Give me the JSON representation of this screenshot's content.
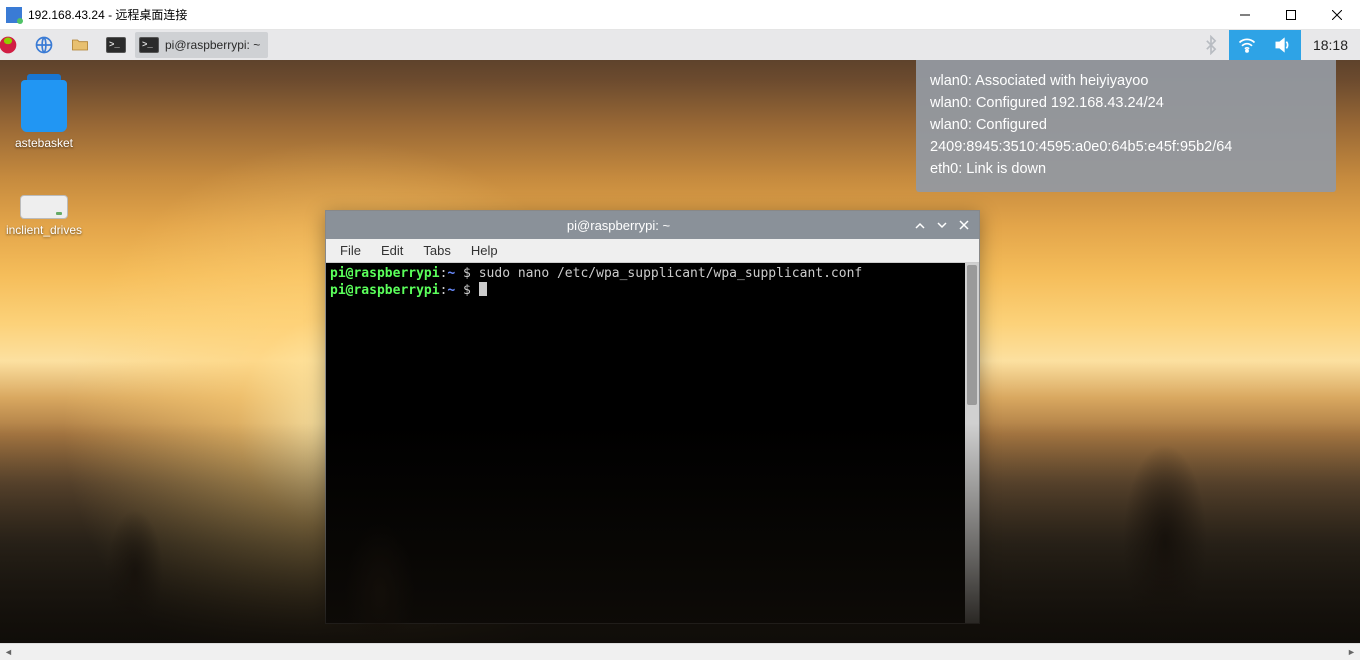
{
  "rdc": {
    "title": "192.168.43.24 - 远程桌面连接"
  },
  "panel": {
    "task_label": "pi@raspberrypi: ~",
    "clock": "18:18"
  },
  "desktop": {
    "trash_label": "astebasket",
    "drives_label": "inclient_drives"
  },
  "nettip": {
    "l1": "wlan0: Associated with heiyiyayoo",
    "l2": "wlan0: Configured 192.168.43.24/24",
    "l3": "wlan0: Configured 2409:8945:3510:4595:a0e0:64b5:e45f:95b2/64",
    "l4": "eth0: Link is down"
  },
  "termwin": {
    "title": "pi@raspberrypi: ~",
    "menu": {
      "file": "File",
      "edit": "Edit",
      "tabs": "Tabs",
      "help": "Help"
    },
    "prompt_user": "pi@raspberrypi",
    "prompt_sep": ":",
    "prompt_path": "~",
    "prompt_sym": " $ ",
    "cmd1": "sudo nano /etc/wpa_supplicant/wpa_supplicant.conf"
  }
}
